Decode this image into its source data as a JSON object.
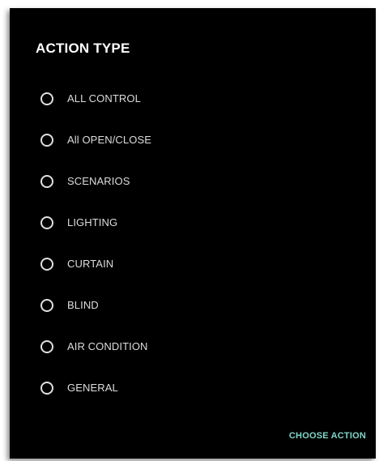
{
  "dialog": {
    "title": "ACTION TYPE",
    "options": [
      {
        "label": "ALL CONTROL",
        "selected": false
      },
      {
        "label": "All OPEN/CLOSE",
        "selected": false
      },
      {
        "label": "SCENARIOS",
        "selected": false
      },
      {
        "label": "LIGHTING",
        "selected": false
      },
      {
        "label": "CURTAIN",
        "selected": false
      },
      {
        "label": "BLIND",
        "selected": false
      },
      {
        "label": "AIR CONDITION",
        "selected": false
      },
      {
        "label": "GENERAL",
        "selected": false
      }
    ],
    "confirm_label": "CHOOSE ACTION"
  },
  "colors": {
    "background": "#000000",
    "title": "#ffffff",
    "text": "#dcdcdc",
    "radio_border": "#e0e0e0",
    "accent": "#7fd6c8"
  }
}
